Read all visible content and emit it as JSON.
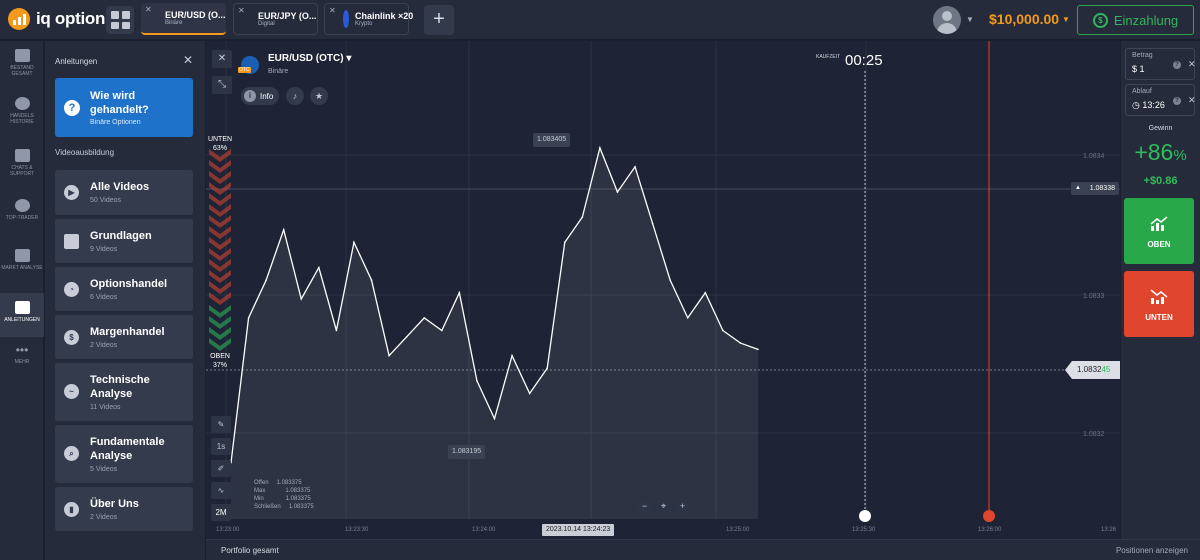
{
  "topbar": {
    "logo_text": "iq option",
    "tabs": [
      {
        "title": "EUR/USD (O...",
        "subtitle": "Binäre"
      },
      {
        "title": "EUR/JPY (O...",
        "subtitle": "Digital"
      },
      {
        "title": "Chainlink ×20",
        "subtitle": "Krypto"
      }
    ],
    "balance": "$10,000.00",
    "deposit_label": "Einzahlung",
    "add_tab": "+"
  },
  "leftnav": {
    "items": [
      {
        "label": "BESTAND GESAMT",
        "icon": "briefcase-icon"
      },
      {
        "label": "HANDELS HISTORIE",
        "icon": "history-icon"
      },
      {
        "label": "CHATS & SUPPORT",
        "icon": "chat-icon"
      },
      {
        "label": "TOP-TRADER",
        "icon": "trophy-icon"
      },
      {
        "label": "MARKT ANALYSE",
        "icon": "analysis-icon"
      },
      {
        "label": "ANLEITUNGEN",
        "icon": "graduation-cap-icon"
      },
      {
        "label": "MEHR",
        "icon": "more-icon"
      }
    ]
  },
  "tutorials": {
    "title": "Anleitungen",
    "feature": {
      "title": "Wie wird gehandelt?",
      "subtitle": "Binäre Optionen"
    },
    "section_title": "Videoausbildung",
    "categories": [
      {
        "title": "Alle Videos",
        "count": "50 Videos",
        "icon": "play-icon"
      },
      {
        "title": "Grundlagen",
        "count": "9 Videos",
        "icon": "folder-icon"
      },
      {
        "title": "Optionshandel",
        "count": "6 Videos",
        "icon": "pie-icon"
      },
      {
        "title": "Margenhandel",
        "count": "2 Videos",
        "icon": "dollar-icon"
      },
      {
        "title": "Technische Analyse",
        "count": "11 Videos",
        "icon": "trend-icon"
      },
      {
        "title": "Fundamentale Analyse",
        "count": "5 Videos",
        "icon": "search-icon"
      },
      {
        "title": "Über Uns",
        "count": "2 Videos",
        "icon": "bars-icon"
      }
    ]
  },
  "chart": {
    "asset_title": "EUR/USD (OTC) ▾",
    "asset_type": "Binäre",
    "info_label": "Info",
    "timer_label": "KAUFZEIT",
    "timer": "00:25",
    "down_label": "UNTEN",
    "down_pct": "63%",
    "up_label": "OBEN",
    "up_pct": "37%",
    "high_tip": "1.083405",
    "low_tip": "1.083195",
    "price_levels": [
      "1.0834",
      "1.0833",
      "1.0832"
    ],
    "alert_price": "1.08338",
    "current_price_main": "1.0832",
    "current_price_last": "45",
    "ohlc": [
      {
        "label": "Offen",
        "value": "1.083375"
      },
      {
        "label": "Max",
        "value": "1.083375"
      },
      {
        "label": "Min",
        "value": "1.083375"
      },
      {
        "label": "Schließen",
        "value": "1.083375"
      }
    ],
    "x_ticks": [
      "13:23:00",
      "13:23:30",
      "13:24:00",
      "13:25:00",
      "13:25:30",
      "13:26:00",
      "13:26"
    ],
    "x_highlight": "2023.10.14 13:24:23",
    "timeframe": "2M",
    "interval": "1s",
    "colors": {
      "line": "#ffffff",
      "up": "#2fbd5a",
      "down": "#e0452e",
      "orange": "#f39a1e"
    }
  },
  "chart_data": {
    "type": "line",
    "xlabel": "",
    "ylabel": "",
    "x": [
      "13:23:00",
      "13:23:04",
      "13:23:08",
      "13:23:12",
      "13:23:16",
      "13:23:20",
      "13:23:24",
      "13:23:28",
      "13:23:32",
      "13:23:36",
      "13:23:40",
      "13:23:44",
      "13:23:48",
      "13:23:52",
      "13:23:56",
      "13:24:00",
      "13:24:04",
      "13:24:08",
      "13:24:12",
      "13:24:16",
      "13:24:20",
      "13:24:24",
      "13:24:28",
      "13:24:32",
      "13:24:36",
      "13:24:40",
      "13:24:44",
      "13:24:48",
      "13:24:52",
      "13:24:56",
      "13:25:00"
    ],
    "series": [
      {
        "values": [
          1.083155,
          1.08327,
          1.0833,
          1.08334,
          1.083285,
          1.08331,
          1.08326,
          1.08333,
          1.0833,
          1.08324,
          1.083255,
          1.08327,
          1.08326,
          1.08329,
          1.08322,
          1.08319,
          1.08324,
          1.08321,
          1.08323,
          1.08333,
          1.08335,
          1.083405,
          1.08337,
          1.08339,
          1.083345,
          1.0833,
          1.08327,
          1.08329,
          1.08326,
          1.08325,
          1.083245
        ]
      }
    ],
    "ylim": [
      1.08315,
      1.08342
    ]
  },
  "right": {
    "amount_label": "Betrag",
    "amount_value": "$ 1",
    "expiry_label": "Ablauf",
    "expiry_value": "◷ 13:26",
    "payout_label": "Gewinn",
    "payout_pct": "+86",
    "payout_pct_unit": "%",
    "payout_amount": "+$0.86",
    "up_button": "OBEN",
    "down_button": "UNTEN"
  },
  "portfolio": {
    "title": "Portfolio gesamt",
    "show_positions": "Positionen anzeigen"
  }
}
